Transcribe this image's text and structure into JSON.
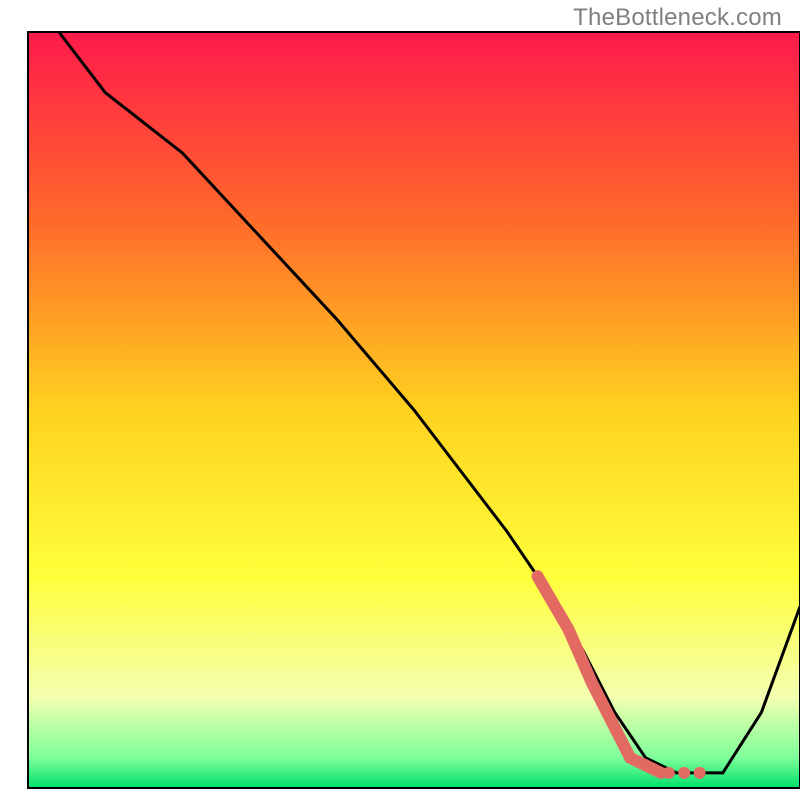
{
  "watermark": "TheBottleneck.com",
  "chart_data": {
    "type": "line",
    "title": "",
    "xlabel": "",
    "ylabel": "",
    "xlim": [
      0,
      100
    ],
    "ylim": [
      0,
      100
    ],
    "x": [
      4,
      10,
      20,
      30,
      40,
      50,
      56,
      62,
      68,
      72,
      76,
      80,
      84,
      90,
      95,
      100
    ],
    "values": [
      100,
      92,
      84,
      73,
      62,
      50,
      42,
      34,
      25,
      18,
      10,
      4,
      2,
      2,
      10,
      24
    ],
    "series": [
      {
        "name": "bottleneck-curve",
        "x": [
          4,
          10,
          20,
          30,
          40,
          50,
          56,
          62,
          68,
          72,
          76,
          80,
          84,
          90,
          95,
          100
        ],
        "values": [
          100,
          92,
          84,
          73,
          62,
          50,
          42,
          34,
          25,
          18,
          10,
          4,
          2,
          2,
          10,
          24
        ]
      },
      {
        "name": "highlight-segment",
        "x": [
          66,
          70,
          73,
          76,
          78,
          80,
          82
        ],
        "values": [
          28,
          21,
          14,
          8,
          4,
          3,
          2
        ]
      },
      {
        "name": "highlight-dots",
        "x": [
          83,
          85,
          87
        ],
        "values": [
          2,
          2,
          2
        ]
      }
    ],
    "gradient_stops": [
      {
        "offset": 0.0,
        "color": "#ff1a4b"
      },
      {
        "offset": 0.25,
        "color": "#ff6a2a"
      },
      {
        "offset": 0.5,
        "color": "#ffd21f"
      },
      {
        "offset": 0.72,
        "color": "#ffff3a"
      },
      {
        "offset": 0.88,
        "color": "#f4ffb0"
      },
      {
        "offset": 0.96,
        "color": "#7dff9a"
      },
      {
        "offset": 1.0,
        "color": "#00e06a"
      }
    ],
    "frame_color": "#000000",
    "curve_color": "#000000",
    "highlight_color": "#e26a63"
  }
}
